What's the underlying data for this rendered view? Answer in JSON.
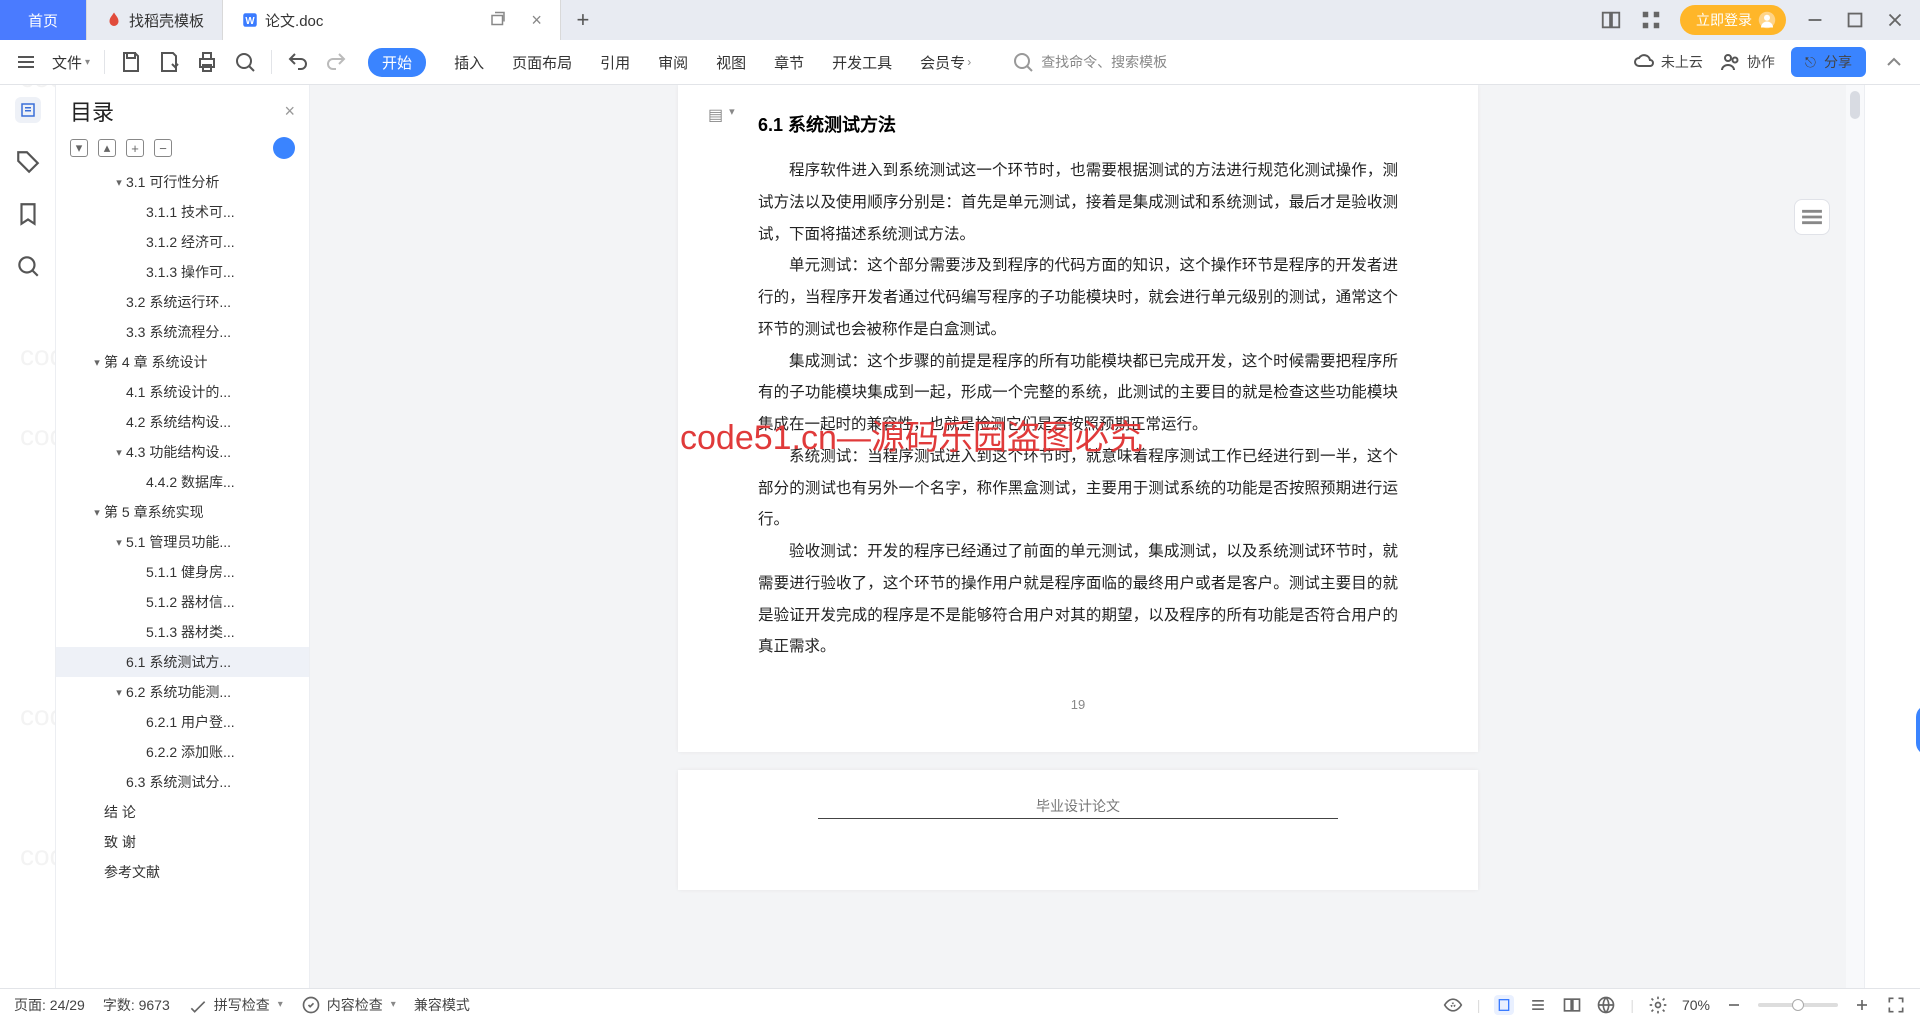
{
  "tabs": {
    "home": "首页",
    "t1": "找稻壳模板",
    "t2": "论文.doc",
    "login": "立即登录"
  },
  "ribbon": {
    "file": "文件",
    "menu": [
      "开始",
      "插入",
      "页面布局",
      "引用",
      "审阅",
      "视图",
      "章节",
      "开发工具",
      "会员专"
    ],
    "search": "查找命令、搜索模板",
    "cloud": "未上云",
    "coop": "协作",
    "share": "分享"
  },
  "sidebar": {
    "title": "目录",
    "items": [
      {
        "lv": 2,
        "chev": "▾",
        "label": "3.1 可行性分析"
      },
      {
        "lv": 3,
        "label": "3.1.1 技术可..."
      },
      {
        "lv": 3,
        "label": "3.1.2 经济可..."
      },
      {
        "lv": 3,
        "label": "3.1.3 操作可..."
      },
      {
        "lv": 2,
        "label": "3.2 系统运行环..."
      },
      {
        "lv": 2,
        "label": "3.3 系统流程分..."
      },
      {
        "lv": 1,
        "chev": "▾",
        "label": "第 4 章  系统设计"
      },
      {
        "lv": 2,
        "label": "4.1 系统设计的..."
      },
      {
        "lv": 2,
        "label": "4.2 系统结构设..."
      },
      {
        "lv": 2,
        "chev": "▾",
        "label": "4.3 功能结构设..."
      },
      {
        "lv": 3,
        "label": "4.4.2 数据库..."
      },
      {
        "lv": 1,
        "chev": "▾",
        "label": "第 5 章系统实现"
      },
      {
        "lv": 2,
        "chev": "▾",
        "label": "5.1 管理员功能..."
      },
      {
        "lv": 3,
        "label": "5.1.1 健身房..."
      },
      {
        "lv": 3,
        "label": "5.1.2 器材信..."
      },
      {
        "lv": 3,
        "label": "5.1.3 器材类..."
      },
      {
        "lv": 2,
        "label": "6.1 系统测试方...",
        "sel": true
      },
      {
        "lv": 2,
        "chev": "▾",
        "label": "6.2 系统功能测..."
      },
      {
        "lv": 3,
        "label": "6.2.1 用户登..."
      },
      {
        "lv": 3,
        "label": "6.2.2 添加账..."
      },
      {
        "lv": 2,
        "label": "6.3 系统测试分..."
      },
      {
        "lv": 1,
        "label": "结  论"
      },
      {
        "lv": 1,
        "label": "致  谢"
      },
      {
        "lv": 1,
        "label": "参考文献"
      }
    ]
  },
  "doc": {
    "heading": "6.1 系统测试方法",
    "p1": "程序软件进入到系统测试这一个环节时，也需要根据测试的方法进行规范化测试操作，测试方法以及使用顺序分别是：首先是单元测试，接着是集成测试和系统测试，最后才是验收测试，下面将描述系统测试方法。",
    "p2": "单元测试：这个部分需要涉及到程序的代码方面的知识，这个操作环节是程序的开发者进行的，当程序开发者通过代码编写程序的子功能模块时，就会进行单元级别的测试，通常这个环节的测试也会被称作是白盒测试。",
    "p3": "集成测试：这个步骤的前提是程序的所有功能模块都已完成开发，这个时候需要把程序所有的子功能模块集成到一起，形成一个完整的系统，此测试的主要目的就是检查这些功能模块集成在一起时的兼容性，也就是检测它们是否按照预期正常运行。",
    "p4": "系统测试：当程序测试进入到这个环节时，就意味着程序测试工作已经进行到一半，这个部分的测试也有另外一个名字，称作黑盒测试，主要用于测试系统的功能是否按照预期进行运行。",
    "p5": "验收测试：开发的程序已经通过了前面的单元测试，集成测试，以及系统测试环节时，就需要进行验收了，这个环节的操作用户就是程序面临的最终用户或者是客户。测试主要目的就是验证开发完成的程序是不是能够符合用户对其的期望，以及程序的所有功能是否符合用户的真正需求。",
    "page_num": "19",
    "footer": "毕业设计论文"
  },
  "status": {
    "page": "页面: 24/29",
    "words": "字数: 9673",
    "spell": "拼写检查",
    "content": "内容检查",
    "compat": "兼容模式",
    "zoom": "70%"
  },
  "wm": "code51.cn",
  "wm2": "code51.cn—源码乐园盗图必究"
}
